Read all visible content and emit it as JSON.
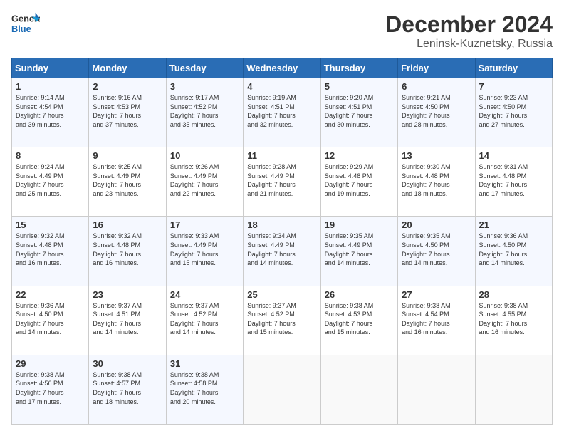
{
  "header": {
    "logo_line1": "General",
    "logo_line2": "Blue",
    "month": "December 2024",
    "location": "Leninsk-Kuznetsky, Russia"
  },
  "days_of_week": [
    "Sunday",
    "Monday",
    "Tuesday",
    "Wednesday",
    "Thursday",
    "Friday",
    "Saturday"
  ],
  "weeks": [
    [
      {
        "day": "1",
        "sunrise": "9:14 AM",
        "sunset": "4:54 PM",
        "daylight": "7 hours and 39 minutes."
      },
      {
        "day": "2",
        "sunrise": "9:16 AM",
        "sunset": "4:53 PM",
        "daylight": "7 hours and 37 minutes."
      },
      {
        "day": "3",
        "sunrise": "9:17 AM",
        "sunset": "4:52 PM",
        "daylight": "7 hours and 35 minutes."
      },
      {
        "day": "4",
        "sunrise": "9:19 AM",
        "sunset": "4:51 PM",
        "daylight": "7 hours and 32 minutes."
      },
      {
        "day": "5",
        "sunrise": "9:20 AM",
        "sunset": "4:51 PM",
        "daylight": "7 hours and 30 minutes."
      },
      {
        "day": "6",
        "sunrise": "9:21 AM",
        "sunset": "4:50 PM",
        "daylight": "7 hours and 28 minutes."
      },
      {
        "day": "7",
        "sunrise": "9:23 AM",
        "sunset": "4:50 PM",
        "daylight": "7 hours and 27 minutes."
      }
    ],
    [
      {
        "day": "8",
        "sunrise": "9:24 AM",
        "sunset": "4:49 PM",
        "daylight": "7 hours and 25 minutes."
      },
      {
        "day": "9",
        "sunrise": "9:25 AM",
        "sunset": "4:49 PM",
        "daylight": "7 hours and 23 minutes."
      },
      {
        "day": "10",
        "sunrise": "9:26 AM",
        "sunset": "4:49 PM",
        "daylight": "7 hours and 22 minutes."
      },
      {
        "day": "11",
        "sunrise": "9:28 AM",
        "sunset": "4:49 PM",
        "daylight": "7 hours and 21 minutes."
      },
      {
        "day": "12",
        "sunrise": "9:29 AM",
        "sunset": "4:48 PM",
        "daylight": "7 hours and 19 minutes."
      },
      {
        "day": "13",
        "sunrise": "9:30 AM",
        "sunset": "4:48 PM",
        "daylight": "7 hours and 18 minutes."
      },
      {
        "day": "14",
        "sunrise": "9:31 AM",
        "sunset": "4:48 PM",
        "daylight": "7 hours and 17 minutes."
      }
    ],
    [
      {
        "day": "15",
        "sunrise": "9:32 AM",
        "sunset": "4:48 PM",
        "daylight": "7 hours and 16 minutes."
      },
      {
        "day": "16",
        "sunrise": "9:32 AM",
        "sunset": "4:48 PM",
        "daylight": "7 hours and 16 minutes."
      },
      {
        "day": "17",
        "sunrise": "9:33 AM",
        "sunset": "4:49 PM",
        "daylight": "7 hours and 15 minutes."
      },
      {
        "day": "18",
        "sunrise": "9:34 AM",
        "sunset": "4:49 PM",
        "daylight": "7 hours and 14 minutes."
      },
      {
        "day": "19",
        "sunrise": "9:35 AM",
        "sunset": "4:49 PM",
        "daylight": "7 hours and 14 minutes."
      },
      {
        "day": "20",
        "sunrise": "9:35 AM",
        "sunset": "4:50 PM",
        "daylight": "7 hours and 14 minutes."
      },
      {
        "day": "21",
        "sunrise": "9:36 AM",
        "sunset": "4:50 PM",
        "daylight": "7 hours and 14 minutes."
      }
    ],
    [
      {
        "day": "22",
        "sunrise": "9:36 AM",
        "sunset": "4:50 PM",
        "daylight": "7 hours and 14 minutes."
      },
      {
        "day": "23",
        "sunrise": "9:37 AM",
        "sunset": "4:51 PM",
        "daylight": "7 hours and 14 minutes."
      },
      {
        "day": "24",
        "sunrise": "9:37 AM",
        "sunset": "4:52 PM",
        "daylight": "7 hours and 14 minutes."
      },
      {
        "day": "25",
        "sunrise": "9:37 AM",
        "sunset": "4:52 PM",
        "daylight": "7 hours and 15 minutes."
      },
      {
        "day": "26",
        "sunrise": "9:38 AM",
        "sunset": "4:53 PM",
        "daylight": "7 hours and 15 minutes."
      },
      {
        "day": "27",
        "sunrise": "9:38 AM",
        "sunset": "4:54 PM",
        "daylight": "7 hours and 16 minutes."
      },
      {
        "day": "28",
        "sunrise": "9:38 AM",
        "sunset": "4:55 PM",
        "daylight": "7 hours and 16 minutes."
      }
    ],
    [
      {
        "day": "29",
        "sunrise": "9:38 AM",
        "sunset": "4:56 PM",
        "daylight": "7 hours and 17 minutes."
      },
      {
        "day": "30",
        "sunrise": "9:38 AM",
        "sunset": "4:57 PM",
        "daylight": "7 hours and 18 minutes."
      },
      {
        "day": "31",
        "sunrise": "9:38 AM",
        "sunset": "4:58 PM",
        "daylight": "7 hours and 20 minutes."
      },
      null,
      null,
      null,
      null
    ]
  ]
}
